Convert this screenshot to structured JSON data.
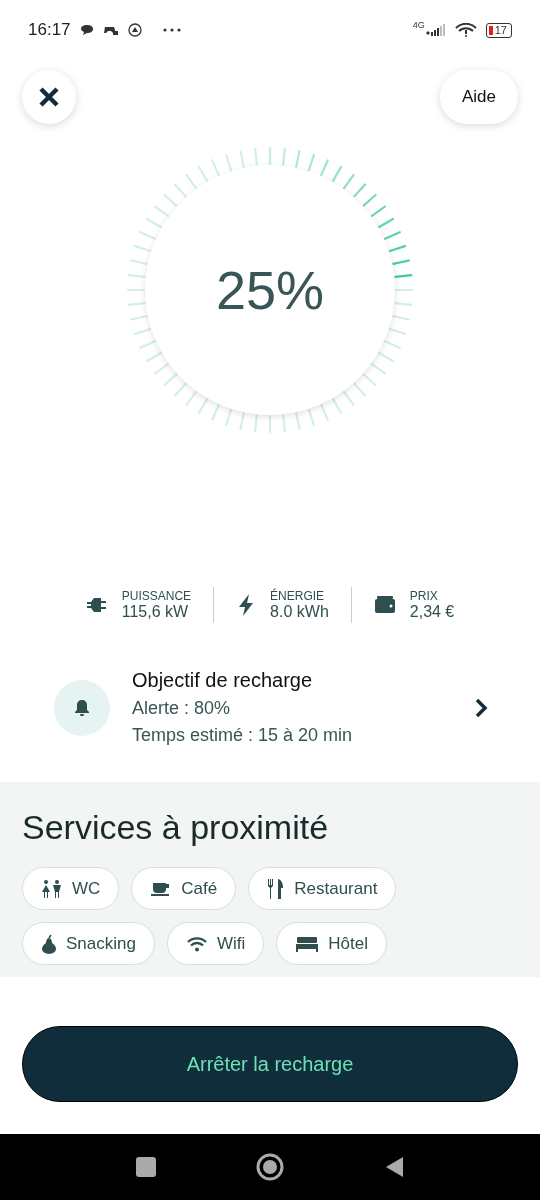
{
  "status_bar": {
    "time": "16:17",
    "network": "4G",
    "battery": "17"
  },
  "header": {
    "help": "Aide"
  },
  "gauge": {
    "reading": "25%"
  },
  "stats": [
    {
      "kind": "plug",
      "label": "PUISSANCE",
      "value": "115,6 kW"
    },
    {
      "kind": "bolt",
      "label": "ÉNERGIE",
      "value": "8.0 kWh"
    },
    {
      "kind": "wallet",
      "label": "PRIX",
      "value": "2,34 €"
    }
  ],
  "goal": {
    "title": "Objectif de recharge",
    "alert": "Alerte : 80%",
    "estimate": "Temps estimé : 15 à 20 min"
  },
  "services": {
    "title": "Services à proximité",
    "items": [
      {
        "kind": "wc",
        "label": "WC"
      },
      {
        "kind": "cafe",
        "label": "Café"
      },
      {
        "kind": "restaurant",
        "label": "Restaurant"
      },
      {
        "kind": "snack",
        "label": "Snacking"
      },
      {
        "kind": "wifi",
        "label": "Wifi"
      },
      {
        "kind": "hotel",
        "label": "Hôtel"
      }
    ]
  },
  "stop_button": "Arrêter la recharge"
}
